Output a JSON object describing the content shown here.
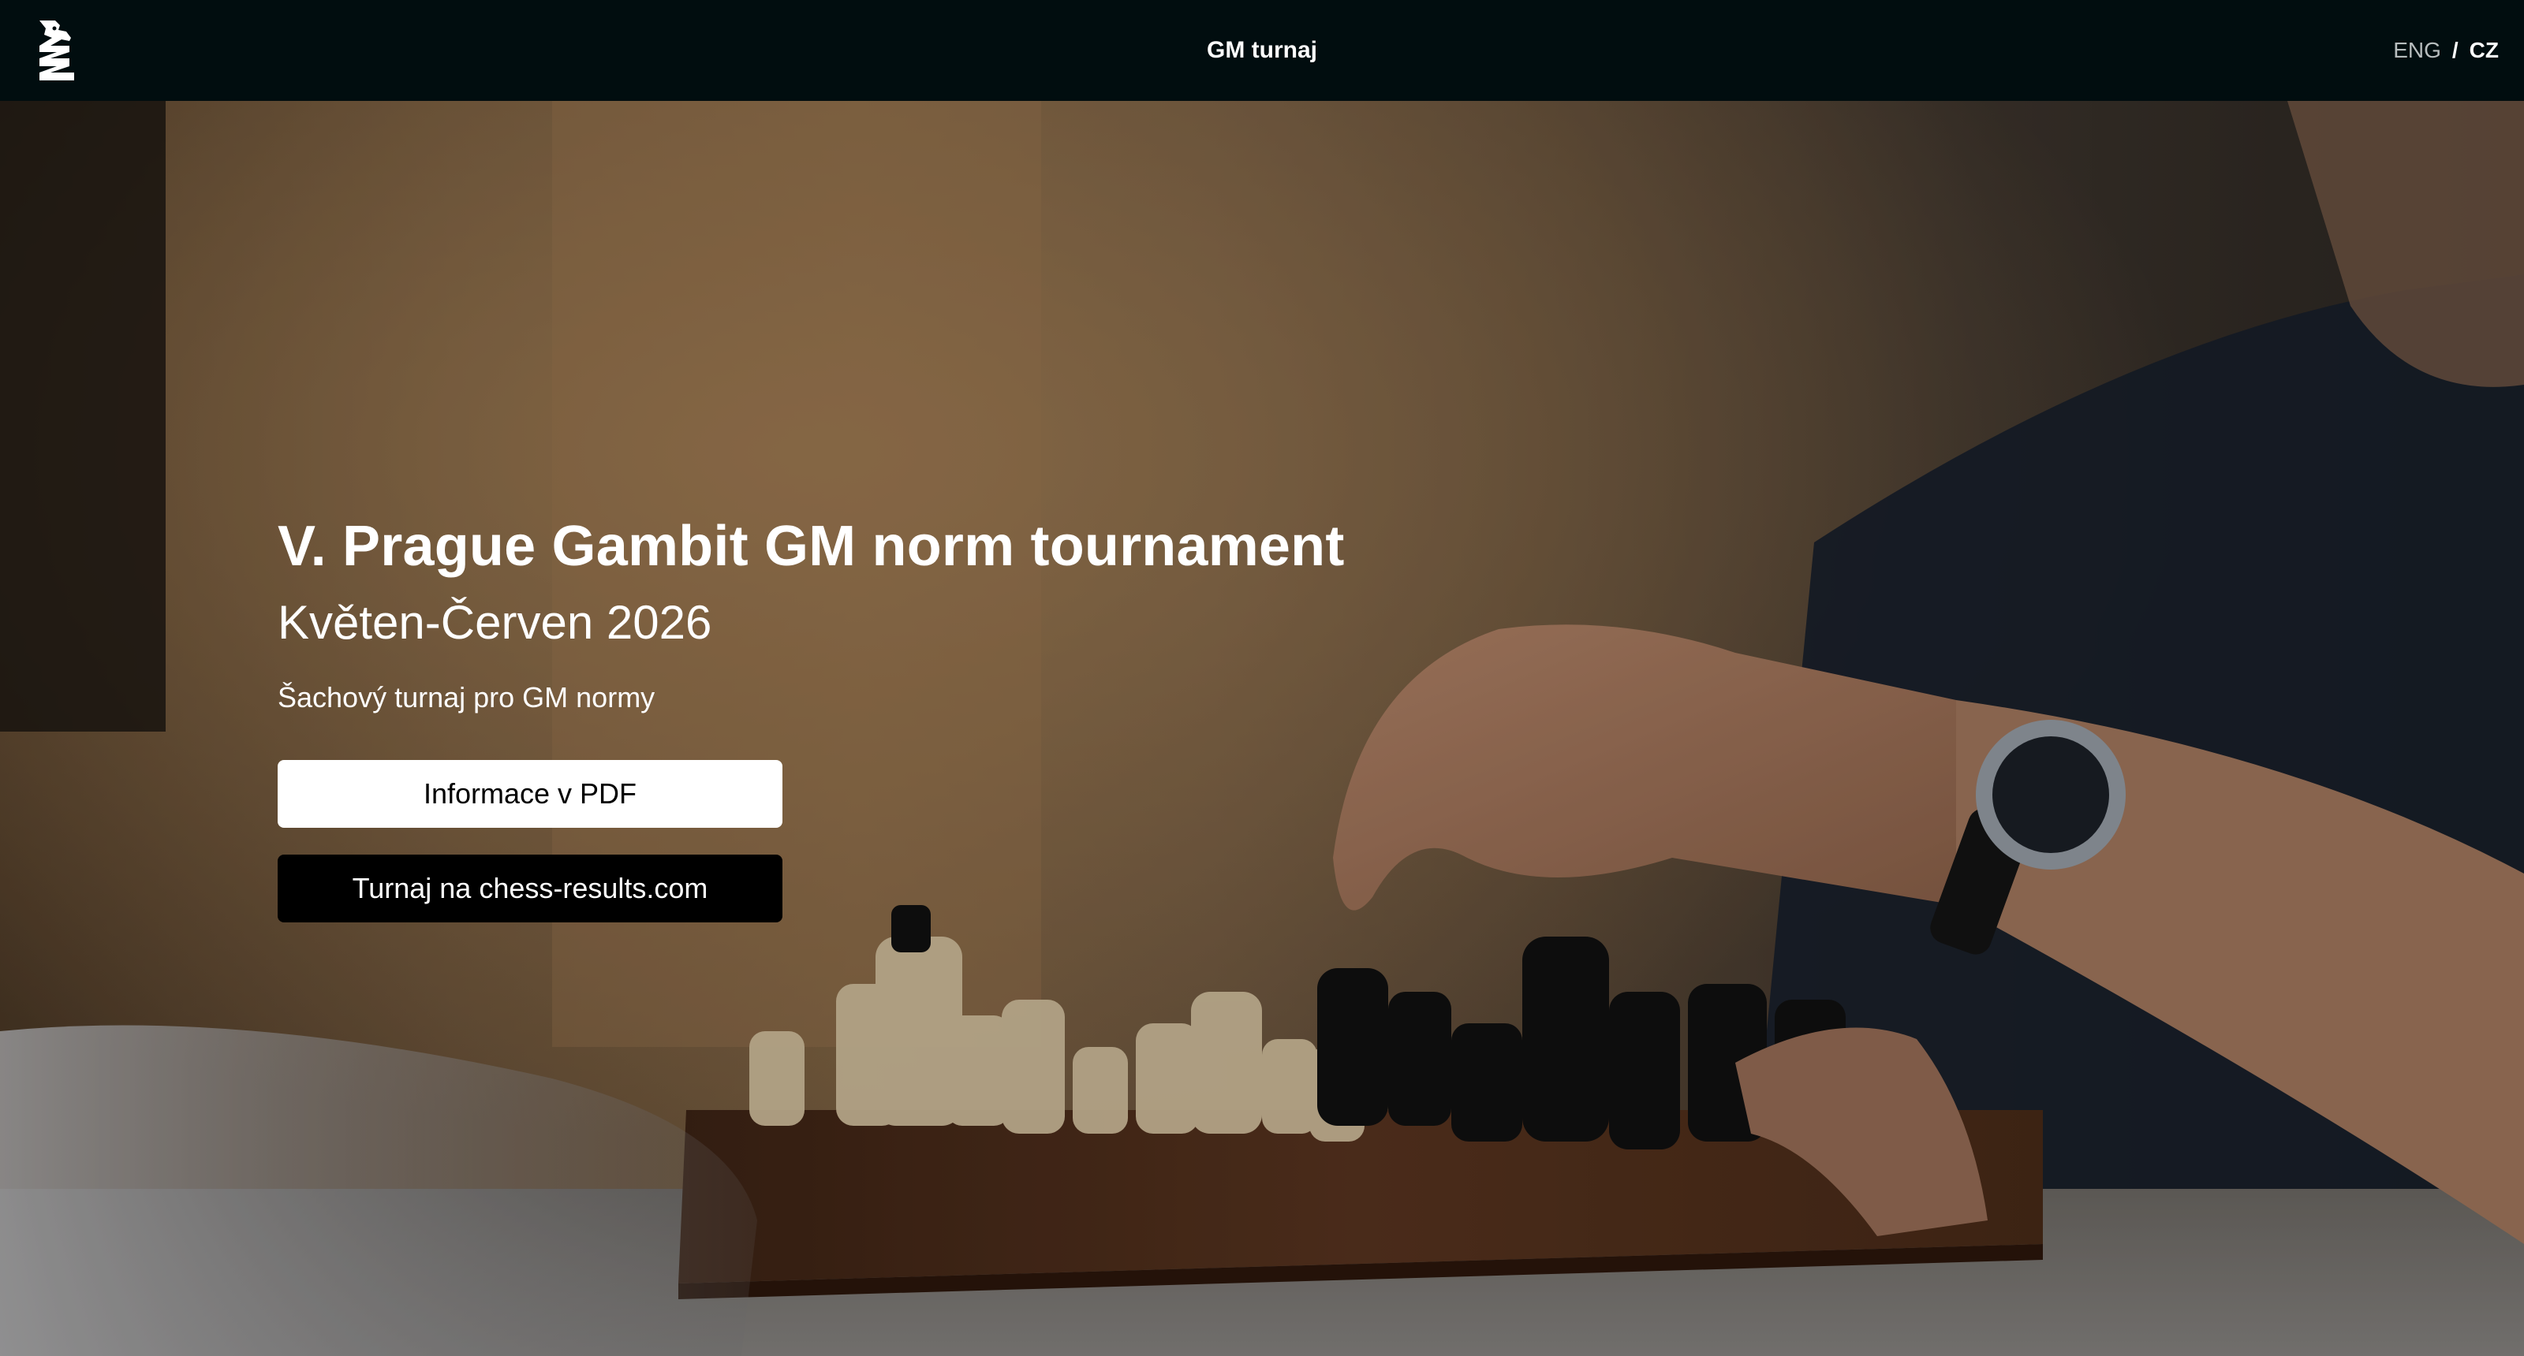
{
  "header": {
    "logo_icon": "chess-knight-logo-icon",
    "title": "GM turnaj",
    "lang_eng": "ENG",
    "lang_separator": "/",
    "lang_cz": "CZ"
  },
  "hero": {
    "title": "V. Prague Gambit GM norm tournament",
    "date": "Květen-Červen 2026",
    "description": "Šachový turnaj pro GM normy",
    "pdf_button_label": "Informace v PDF",
    "results_button_label": "Turnaj na chess-results.com",
    "background_image": "chess-game-photo"
  },
  "colors": {
    "topbar_bg": "#010d0f",
    "primary_button_bg": "#ffffff",
    "secondary_button_bg": "#000000"
  }
}
